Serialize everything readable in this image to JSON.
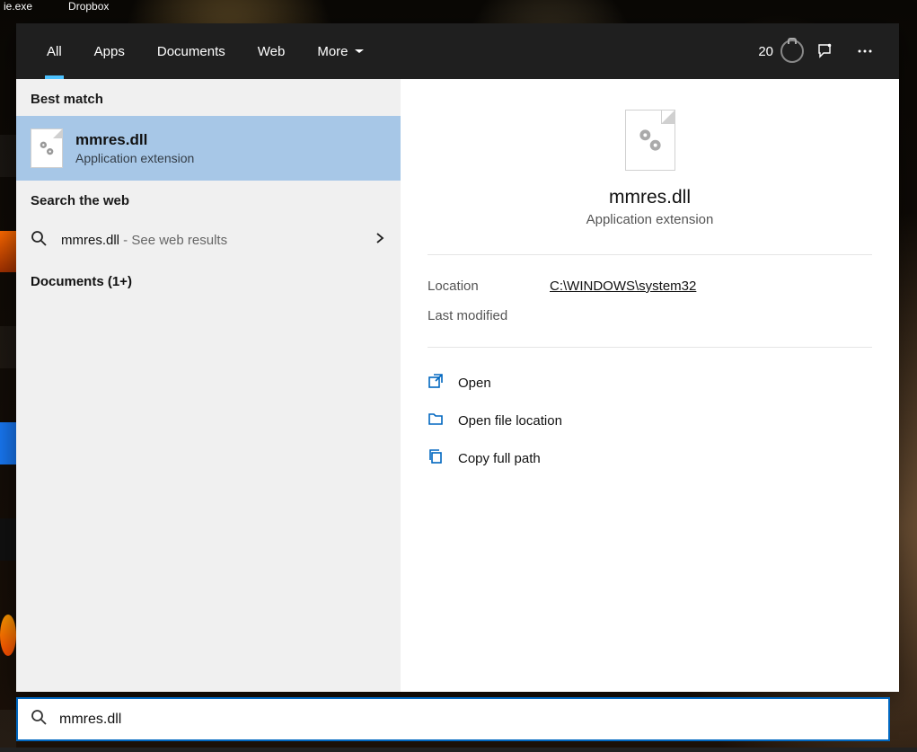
{
  "desktop": {
    "top_labels": [
      "ie.exe",
      "Dropbox"
    ]
  },
  "header": {
    "tabs": [
      {
        "label": "All",
        "active": true
      },
      {
        "label": "Apps"
      },
      {
        "label": "Documents"
      },
      {
        "label": "Web"
      },
      {
        "label": "More"
      }
    ],
    "rewards_points": "20"
  },
  "results": {
    "best_match_label": "Best match",
    "best_match": {
      "title": "mmres.dll",
      "subtitle": "Application extension"
    },
    "search_web_label": "Search the web",
    "web_row": {
      "query": "mmres.dll",
      "hint": " - See web results"
    },
    "documents_label": "Documents (1+)"
  },
  "preview": {
    "title": "mmres.dll",
    "subtitle": "Application extension",
    "meta": {
      "location_key": "Location",
      "location_val": "C:\\WINDOWS\\system32",
      "modified_key": "Last modified",
      "modified_val": ""
    },
    "actions": {
      "open": "Open",
      "open_loc": "Open file location",
      "copy_path": "Copy full path"
    }
  },
  "search": {
    "value": "mmres.dll"
  }
}
